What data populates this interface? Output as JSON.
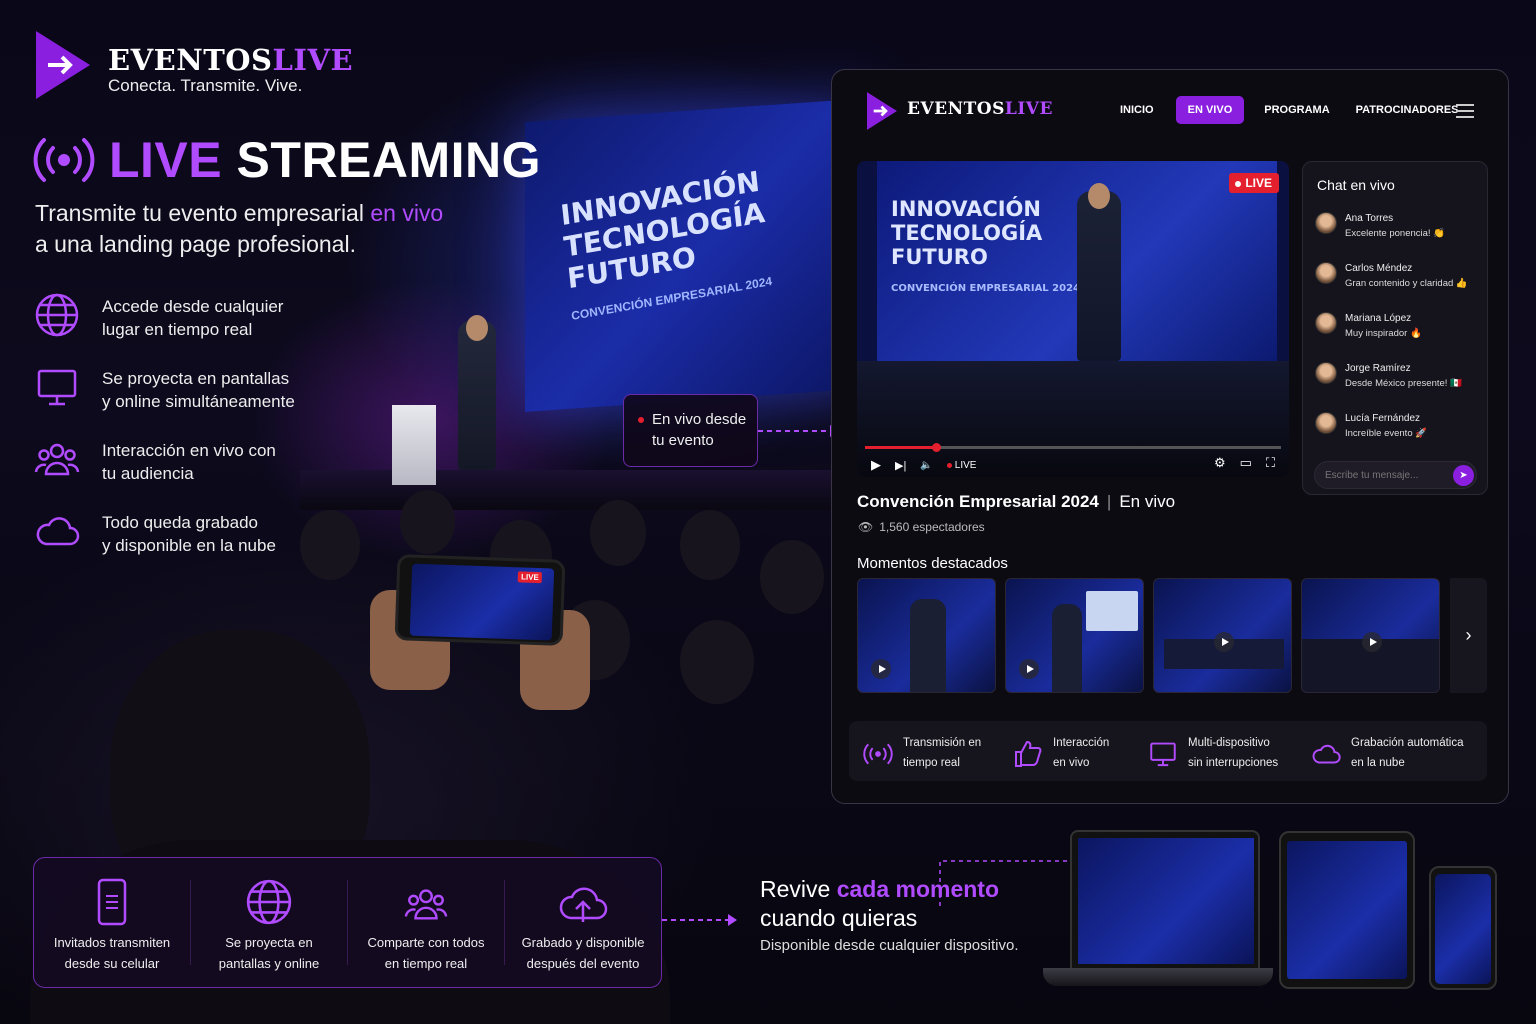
{
  "brand": {
    "name_a": "EVENTOS",
    "name_b": "LIVE",
    "tagline": "Conecta. Transmite. Vive."
  },
  "hero": {
    "title_a": "LIVE",
    "title_b": "STREAMING",
    "subtitle_a": "Transmite tu evento empresarial ",
    "subtitle_b": "en vivo",
    "subtitle_c": "a una landing page profesional."
  },
  "stage_screen": {
    "line1": "INNOVACIÓN",
    "line2": "TECNOLOGÍA",
    "line3": "FUTURO",
    "line4": "CONVENCIÓN EMPRESARIAL 2024"
  },
  "features": [
    {
      "icon": "globe-icon",
      "line1": "Accede desde cualquier",
      "line2": "lugar en tiempo real"
    },
    {
      "icon": "monitor-icon",
      "line1": "Se proyecta en pantallas",
      "line2": "y online simultáneamente"
    },
    {
      "icon": "users-icon",
      "line1": "Interacción en vivo con",
      "line2": "tu audiencia"
    },
    {
      "icon": "cloud-icon",
      "line1": "Todo queda grabado",
      "line2": "y disponible en la nube"
    }
  ],
  "callout": {
    "line1": "En vivo desde",
    "line2": "tu evento"
  },
  "strip": [
    {
      "icon": "phone-icon",
      "line1": "Invitados transmiten",
      "line2": "desde su celular"
    },
    {
      "icon": "globe-icon",
      "line1": "Se proyecta en",
      "line2": "pantallas y online"
    },
    {
      "icon": "users-icon",
      "line1": "Comparte con todos",
      "line2": "en tiempo real"
    },
    {
      "icon": "cloud-upload-icon",
      "line1": "Grabado y disponible",
      "line2": "después del evento"
    }
  ],
  "revive": {
    "a": "Revive ",
    "b": "cada momento",
    "c": "cuando quieras",
    "sub": "Disponible desde cualquier dispositivo."
  },
  "panel": {
    "nav": {
      "inicio": "INICIO",
      "en_vivo": "EN VIVO",
      "programa": "PROGRAMA",
      "patrocinadores": "PATROCINADORES"
    },
    "player": {
      "live_badge": "LIVE",
      "live_label": "LIVE",
      "progress": 0.17
    },
    "video_title": "Convención Empresarial 2024",
    "video_status": "En vivo",
    "viewers": "1,560 espectadores",
    "highlights_title": "Momentos destacados",
    "chat": {
      "title": "Chat en vivo",
      "placeholder": "Escribe tu mensaje...",
      "messages": [
        {
          "name": "Ana Torres",
          "msg": "Excelente ponencia! 👏"
        },
        {
          "name": "Carlos Méndez",
          "msg": "Gran contenido y claridad 👍"
        },
        {
          "name": "Mariana López",
          "msg": "Muy inspirador 🔥"
        },
        {
          "name": "Jorge Ramírez",
          "msg": "Desde México presente! 🇲🇽"
        },
        {
          "name": "Lucía Fernández",
          "msg": "Increíble evento 🚀"
        }
      ]
    },
    "bottom_features": [
      {
        "icon": "broadcast-icon",
        "line1": "Transmisión en",
        "line2": "tiempo real"
      },
      {
        "icon": "thumbs-up-icon",
        "line1": "Interacción",
        "line2": "en vivo"
      },
      {
        "icon": "monitor-icon",
        "line1": "Multi-dispositivo",
        "line2": "sin interrupciones"
      },
      {
        "icon": "cloud-icon",
        "line1": "Grabación automática",
        "line2": "en la nube"
      }
    ]
  },
  "colors": {
    "accent": "#b14bff",
    "live_red": "#e5202e",
    "nav_active": "#8a1fe0"
  }
}
